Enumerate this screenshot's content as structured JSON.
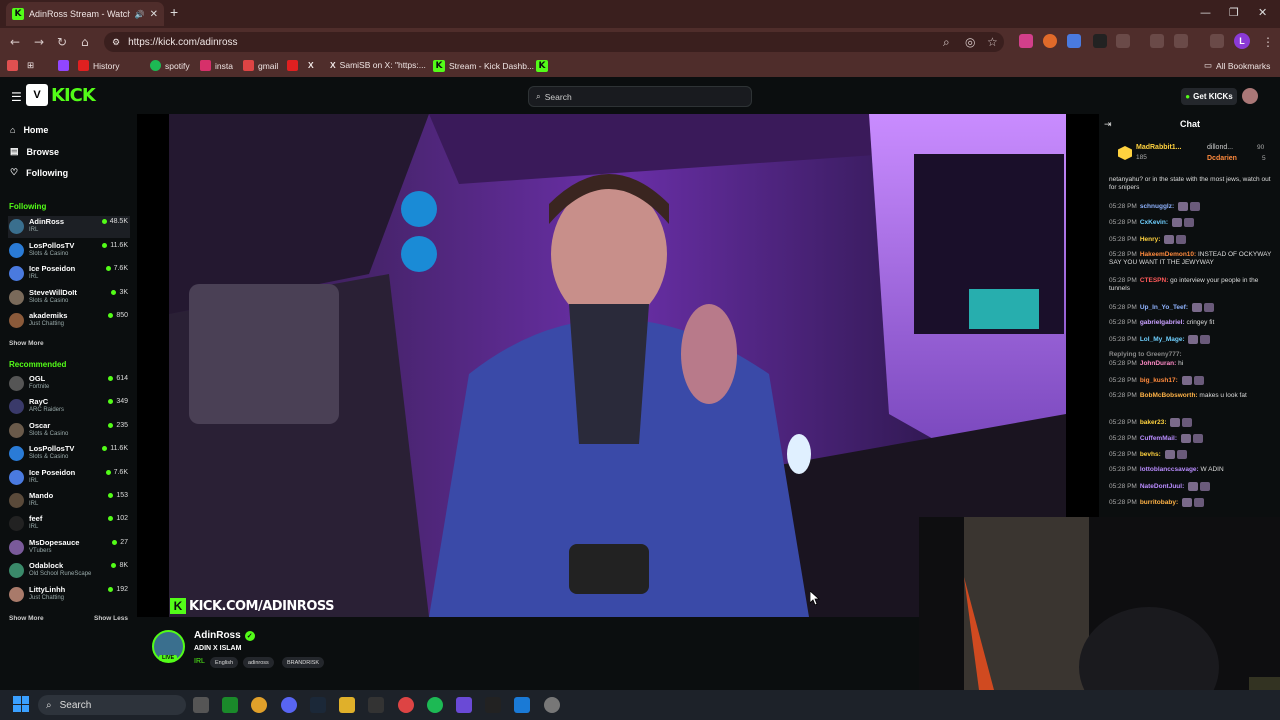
{
  "browser": {
    "tab_title": "AdinRoss Stream - Watch L",
    "url": "https://kick.com/adinross",
    "bookmarks": [
      "History",
      "spotify",
      "insta",
      "gmail",
      "SamiSB on X: \"https:...",
      "Stream - Kick Dashb..."
    ],
    "all_bookmarks": "All Bookmarks",
    "profile_initial": "L"
  },
  "kick": {
    "search_placeholder": "Search",
    "get_kicks": "Get KICKs",
    "nav": [
      {
        "label": "Home",
        "icon": "home-icon"
      },
      {
        "label": "Browse",
        "icon": "browse-icon"
      },
      {
        "label": "Following",
        "icon": "heart-icon"
      }
    ],
    "following_header": "Following",
    "following": [
      {
        "name": "AdinRoss",
        "category": "IRL",
        "viewers": "48.5K",
        "color": "#3a6f8e"
      },
      {
        "name": "LosPollosTV",
        "category": "Slots & Casino",
        "viewers": "11.6K",
        "color": "#2a7bd6"
      },
      {
        "name": "Ice Poseidon",
        "category": "IRL",
        "viewers": "7.6K",
        "color": "#4a7adf"
      },
      {
        "name": "SteveWillDoIt",
        "category": "Slots & Casino",
        "viewers": "3K",
        "color": "#7a6a5a"
      },
      {
        "name": "akademiks",
        "category": "Just Chatting",
        "viewers": "850",
        "color": "#8b5a3a"
      }
    ],
    "show_more_following": "Show More",
    "recommended_header": "Recommended",
    "recommended": [
      {
        "name": "OGL",
        "category": "Fortnite",
        "viewers": "614",
        "color": "#555"
      },
      {
        "name": "RayC",
        "category": "ARC Raiders",
        "viewers": "349",
        "color": "#3a3a6a"
      },
      {
        "name": "Oscar",
        "category": "Slots & Casino",
        "viewers": "235",
        "color": "#6a5a4a"
      },
      {
        "name": "LosPollosTV",
        "category": "Slots & Casino",
        "viewers": "11.6K",
        "color": "#2a7bd6"
      },
      {
        "name": "Ice Poseidon",
        "category": "IRL",
        "viewers": "7.6K",
        "color": "#4a7adf"
      },
      {
        "name": "Mando",
        "category": "IRL",
        "viewers": "153",
        "color": "#5a4a3a"
      },
      {
        "name": "feef",
        "category": "IRL",
        "viewers": "102",
        "color": "#222"
      },
      {
        "name": "MsDopesauce",
        "category": "VTubers",
        "viewers": "27",
        "color": "#7a5a9a"
      },
      {
        "name": "Odablock",
        "category": "Old School RuneScape",
        "viewers": "8K",
        "color": "#3a8a6a"
      },
      {
        "name": "LittyLinhh",
        "category": "Just Chatting",
        "viewers": "192",
        "color": "#a97a6a"
      }
    ],
    "show_more_rec": "Show More",
    "show_less_rec": "Show Less",
    "overlay_url": "KICK.COM/ADINROSS",
    "stream": {
      "streamer": "AdinRoss",
      "title": "ADIN X ISLAM",
      "category": "IRL",
      "tags": [
        "English",
        "adinross",
        "BRANDRISK"
      ],
      "live": "LIVE"
    }
  },
  "chat": {
    "header": "Chat",
    "pinned": [
      {
        "name": "MadRabbit1...",
        "count": "185"
      },
      {
        "name": "dillond...",
        "count": "90"
      },
      {
        "name": "Dcdarien",
        "count": "5"
      }
    ],
    "messages": [
      {
        "time": "",
        "user": "",
        "color": "#ddd",
        "text": "netanyahu? or in the state with the most jews, watch out for snipers"
      },
      {
        "time": "05:28 PM",
        "user": "schnugglz:",
        "color": "#8fb3ff",
        "text": ""
      },
      {
        "time": "05:28 PM",
        "user": "CxKevin:",
        "color": "#6fd0ff",
        "text": ""
      },
      {
        "time": "05:28 PM",
        "user": "Henry:",
        "color": "#ffd23f",
        "text": ""
      },
      {
        "time": "05:28 PM",
        "user": "HakeemDemon10:",
        "color": "#ff8a3d",
        "text": "INSTEAD OF OCKYWAY SAY YOU WANT IT THE JEWYWAY"
      },
      {
        "time": "05:28 PM",
        "user": "CTESPN:",
        "color": "#ff5a5a",
        "text": "go interview your people in the tunnels"
      },
      {
        "time": "05:28 PM",
        "user": "Up_In_Yo_Teef:",
        "color": "#8fb3ff",
        "text": ""
      },
      {
        "time": "05:28 PM",
        "user": "gabrielgabriel:",
        "color": "#c9a0ff",
        "text": "cringey fit"
      },
      {
        "time": "05:28 PM",
        "user": "Lol_My_Mage:",
        "color": "#6fd0ff",
        "text": ""
      },
      {
        "time": "",
        "user": "Replying to Greeny777:",
        "color": "#888",
        "text": ""
      },
      {
        "time": "05:28 PM",
        "user": "JohnDuran:",
        "color": "#ff8ac6",
        "text": "hi"
      },
      {
        "time": "05:28 PM",
        "user": "big_kush17:",
        "color": "#ff8a3d",
        "text": ""
      },
      {
        "time": "05:28 PM",
        "user": "BobMcBobsworth:",
        "color": "#ffb347",
        "text": "makes u look fat"
      },
      {
        "time": "05:28 PM",
        "user": "baker23:",
        "color": "#ffd23f",
        "text": ""
      },
      {
        "time": "05:28 PM",
        "user": "CuffemMail:",
        "color": "#b98cff",
        "text": ""
      },
      {
        "time": "05:28 PM",
        "user": "bevhs:",
        "color": "#ffd23f",
        "text": ""
      },
      {
        "time": "05:28 PM",
        "user": "lottoblanccsavage:",
        "color": "#b98cff",
        "text": "W ADIN"
      },
      {
        "time": "05:28 PM",
        "user": "NateDontJuul:",
        "color": "#b98cff",
        "text": ""
      },
      {
        "time": "05:28 PM",
        "user": "burritobaby:",
        "color": "#ffb347",
        "text": ""
      }
    ]
  },
  "taskbar": {
    "search": "Search"
  }
}
